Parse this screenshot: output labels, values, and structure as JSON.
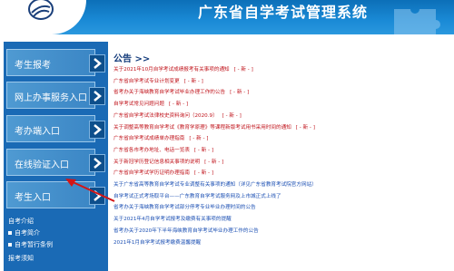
{
  "header": {
    "title": "广东省自学考试管理系统"
  },
  "colors": {
    "header_blue": "#1a8ad6",
    "nav_blue": "#1a6ab5",
    "red_link": "#c0121a",
    "blue_link": "#1b4fb3"
  },
  "nav": {
    "buttons": [
      {
        "label": "考生报考"
      },
      {
        "label": "网上办事服务入口"
      },
      {
        "label": "考办端入口"
      },
      {
        "label": "在线验证入口"
      },
      {
        "label": "考生入口"
      }
    ],
    "section_title": "自考介绍",
    "sub_items": [
      {
        "label": "自考简介"
      },
      {
        "label": "自考暂行条例"
      }
    ],
    "section_title_2": "报考须知"
  },
  "main": {
    "heading": "公告 >>",
    "new_tag": "[ - 新 - ]",
    "notices": [
      {
        "text": "关于2021年10月自学考试成绩报考有关事项的通知",
        "color": "red",
        "new": true
      },
      {
        "text": "广东省自学考试专业计划变更",
        "color": "red",
        "new": true
      },
      {
        "text": "省考办关于海峡教育自学考试毕业办理工作的公告",
        "color": "red",
        "new": true
      },
      {
        "text": "自学考试常见问题问题",
        "color": "red",
        "new": true
      },
      {
        "text": "广东省自学考试法律校史资料询问（2020.9）",
        "color": "red",
        "new": true
      },
      {
        "text": "关于调整高等教育自学考试《教育学原理》等课程新版考试用书采用时间的通知",
        "color": "red",
        "new": true
      },
      {
        "text": "广东省自学考试成绩单办理指南",
        "color": "red",
        "new": true
      },
      {
        "text": "广东省各市考办地址、电话一览表",
        "color": "red",
        "new": true
      },
      {
        "text": "关于新冠学历登记信息相关事项的说明",
        "color": "red",
        "new": true
      },
      {
        "text": "广东省自学考试学历证明办理指南",
        "color": "red",
        "new": true
      },
      {
        "text": "关于广东省高等教育自学考试专业调整有关事项的通知（详见广东省教育考试院官方网站）",
        "color": "blue",
        "new": false
      },
      {
        "text": "自学考试正式考场取平台——广东教育自学考试服务网及上市城正式上线了",
        "color": "blue",
        "new": false
      },
      {
        "text": "省考办关于海峡教育自学考试部分停考专业毕业办理时间的公告",
        "color": "blue",
        "new": false
      },
      {
        "text": "关于2021年4月自学考试报考及缴费有关事项的提醒",
        "color": "blue",
        "new": false
      },
      {
        "text": "省考办关于2020年下半年海峡教育自学考试毕业办理工作的公告",
        "color": "blue",
        "new": false
      },
      {
        "text": "2021年1月自学考试报考缴费温馨提醒",
        "color": "blue",
        "new": false
      }
    ]
  }
}
